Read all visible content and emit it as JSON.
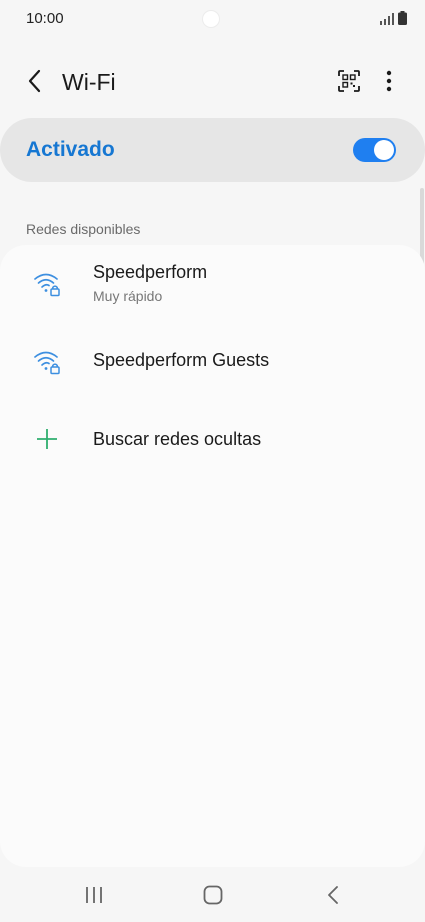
{
  "status_bar": {
    "time": "10:00",
    "icons": [
      "signal-icon",
      "battery-icon"
    ]
  },
  "header": {
    "title": "Wi-Fi",
    "icons": [
      "back-arrow-icon",
      "qr-code-icon",
      "more-vert-icon"
    ]
  },
  "master_switch": {
    "label": "Activado",
    "on": true,
    "accent_color": "#1677d2"
  },
  "section": {
    "label": "Redes disponibles"
  },
  "networks": [
    {
      "name": "Speedperform",
      "subtitle": "Muy rápido",
      "icon": "wifi-lock-icon"
    },
    {
      "name": "Speedperform Guests",
      "subtitle": "",
      "icon": "wifi-lock-icon"
    }
  ],
  "add_network": {
    "label": "Buscar redes ocultas",
    "icon": "plus-icon",
    "icon_color": "#2fae6e"
  },
  "nav_bar": {
    "icons": [
      "recent-apps-icon",
      "home-icon",
      "back-icon"
    ]
  }
}
